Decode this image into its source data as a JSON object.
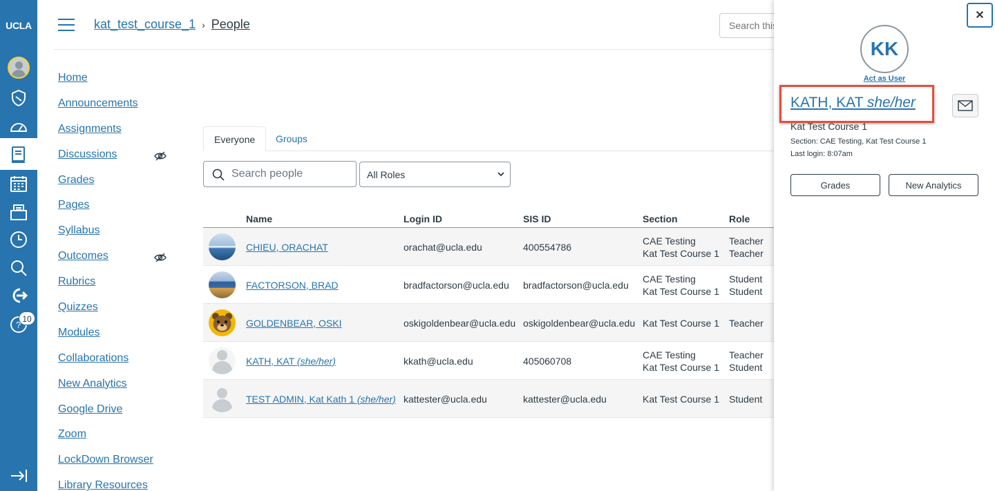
{
  "global_nav": {
    "logo": "UCLA",
    "help_badge": "10",
    "icons": [
      "account-avatar",
      "admin-icon",
      "dashboard-icon",
      "courses-icon",
      "calendar-icon",
      "inbox-icon",
      "history-icon",
      "search-icon",
      "logout-icon",
      "help-icon",
      "collapse-icon"
    ],
    "color": "#2774ae"
  },
  "header": {
    "course_link": "kat_test_course_1",
    "separator": "›",
    "current_page": "People",
    "search_placeholder": "Search this"
  },
  "course_nav": [
    {
      "label": "Home",
      "hidden": false
    },
    {
      "label": "Announcements",
      "hidden": false
    },
    {
      "label": "Assignments",
      "hidden": false
    },
    {
      "label": "Discussions",
      "hidden": true
    },
    {
      "label": "Grades",
      "hidden": false
    },
    {
      "label": "Pages",
      "hidden": false
    },
    {
      "label": "Syllabus",
      "hidden": false
    },
    {
      "label": "Outcomes",
      "hidden": true
    },
    {
      "label": "Rubrics",
      "hidden": false
    },
    {
      "label": "Quizzes",
      "hidden": false
    },
    {
      "label": "Modules",
      "hidden": false
    },
    {
      "label": "Collaborations",
      "hidden": false
    },
    {
      "label": "New Analytics",
      "hidden": false
    },
    {
      "label": "Google Drive",
      "hidden": false
    },
    {
      "label": "Zoom",
      "hidden": false
    },
    {
      "label": "LockDown Browser",
      "hidden": false
    },
    {
      "label": "Library Resources",
      "hidden": false
    }
  ],
  "tabs": {
    "everyone": "Everyone",
    "groups": "Groups"
  },
  "filters": {
    "search_placeholder": "Search people",
    "role_selected": "All Roles"
  },
  "table": {
    "headers": {
      "name": "Name",
      "login_id": "Login ID",
      "sis_id": "SIS ID",
      "section": "Section",
      "role": "Role"
    },
    "rows": [
      {
        "name": "CHIEU, ORACHAT",
        "pronouns": "",
        "login": "orachat@ucla.edu",
        "sis": "400554786",
        "section1": "CAE Testing",
        "section2": "Kat Test Course 1",
        "role1": "Teacher",
        "role2": "Teacher",
        "avatar": "ocean-photo"
      },
      {
        "name": "FACTORSON, BRAD",
        "pronouns": "",
        "login": "bradfactorson@ucla.edu",
        "sis": "bradfactorson@ucla.edu",
        "section1": "CAE Testing",
        "section2": "Kat Test Course 1",
        "role1": "Student",
        "role2": "Student",
        "avatar": "sign-photo"
      },
      {
        "name": "GOLDENBEAR, OSKI",
        "pronouns": "",
        "login": "oskigoldenbear@ucla.edu",
        "sis": "oskigoldenbear@ucla.edu",
        "section1": "Kat Test Course 1",
        "section2": "",
        "role1": "Teacher",
        "role2": "",
        "avatar": "bear-photo"
      },
      {
        "name": "KATH, KAT",
        "pronouns": "(she/her)",
        "login": "kkath@ucla.edu",
        "sis": "405060708",
        "section1": "CAE Testing",
        "section2": "Kat Test Course 1",
        "role1": "Teacher",
        "role2": "Student",
        "avatar": "default"
      },
      {
        "name": "TEST ADMIN, Kat Kath 1",
        "pronouns": "(she/her)",
        "login": "kattester@ucla.edu",
        "sis": "kattester@ucla.edu",
        "section1": "Kat Test Course 1",
        "section2": "",
        "role1": "Student",
        "role2": "",
        "avatar": "default"
      }
    ]
  },
  "tray": {
    "initials": "KK",
    "act_as": "Act as User",
    "name": "KATH, KAT",
    "pronouns": "she/her",
    "course": "Kat Test Course 1",
    "section": "Section: CAE Testing, Kat Test Course 1",
    "last_login": "Last login: 8:07am",
    "grades_button": "Grades",
    "analytics_button": "New Analytics",
    "close_glyph": "✕",
    "highlight_color": "#e74c3c"
  }
}
